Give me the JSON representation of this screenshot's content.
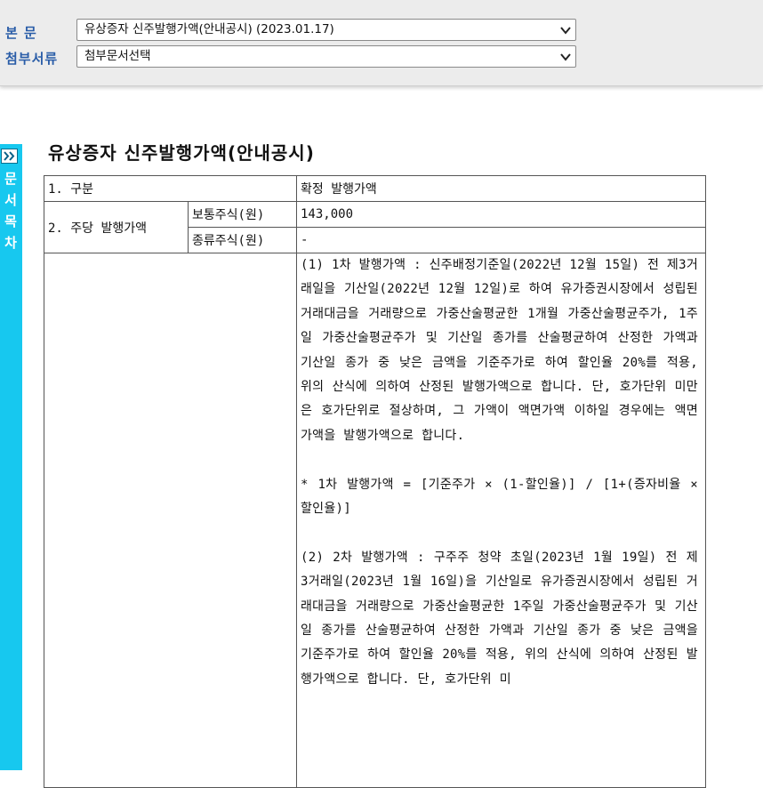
{
  "header": {
    "main_label": "본 문",
    "main_select_value": "유상증자 신주발행가액(안내공시) (2023.01.17)",
    "attach_label": "첨부서류",
    "attach_select_value": "첨부문서선택"
  },
  "sidebar": {
    "toggle_icon": "double-chevron-right-icon",
    "label": "문서목차"
  },
  "document": {
    "title": "유상증자 신주발행가액(안내공시)",
    "rows": {
      "category_label": "1. 구분",
      "category_value": "확정 발행가액",
      "price_label": "2. 주당 발행가액",
      "common_label": "보통주식(원)",
      "common_value": "143,000",
      "preferred_label": "종류주식(원)",
      "preferred_value": "-"
    },
    "body": {
      "p1": "(1) 1차 발행가액 : 신주배정기준일(2022년 12월 15일) 전 제3거래일을 기산일(2022년 12월 12일)로 하여 유가증권시장에서 성립된 거래대금을 거래량으로 가중산술평균한 1개월 가중산술평균주가, 1주일 가중산술평균주가 및 기산일 종가를 산술평균하여 산정한 가액과 기산일 종가 중 낮은 금액을 기준주가로 하여 할인율 20%를 적용, 위의 산식에 의하여 산정된 발행가액으로 합니다. 단, 호가단위 미만은 호가단위로 절상하며, 그 가액이 액면가액 이하일 경우에는 액면가액을 발행가액으로 합니다.",
      "formula": "* 1차 발행가액 = [기준주가 × (1-할인율)] / [1+(증자비율 × 할인율)]",
      "p2": "(2) 2차 발행가액 : 구주주 청약 초일(2023년 1월 19일) 전 제 3거래일(2023년 1월 16일)을 기산일로 유가증권시장에서 성립된 거래대금을 거래량으로 가중산술평균한 1주일 가중산술평균주가 및 기산일 종가를 산술평균하여 산정한 가액과 기산일 종가 중 낮은 금액을 기준주가로 하여 할인율 20%를 적용, 위의 산식에 의하여 산정된 발행가액으로 합니다. 단, 호가단위 미"
    }
  },
  "colors": {
    "label_blue": "#2a5da8",
    "sidebar_cyan": "#17c8ef",
    "topbar_bg": "#ececec"
  }
}
